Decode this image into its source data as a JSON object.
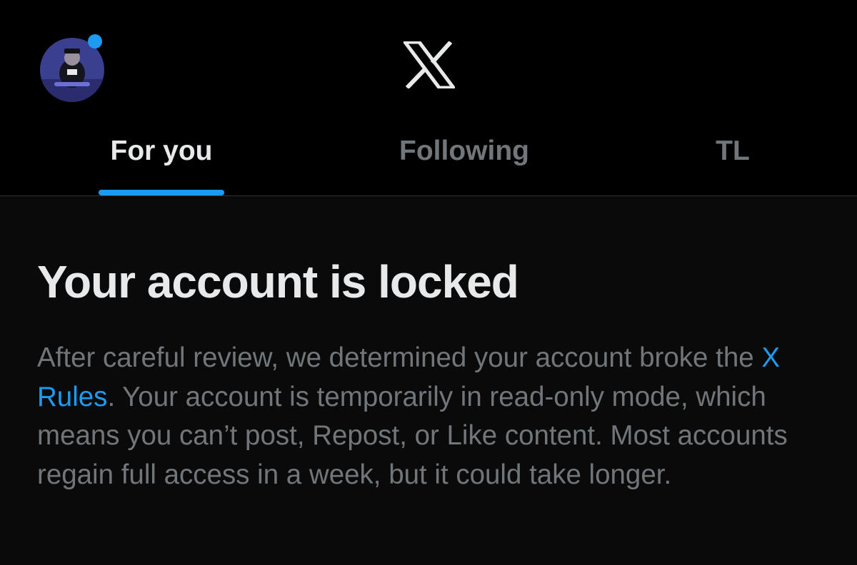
{
  "header": {
    "logo": "X",
    "avatar_icon": "profile-avatar",
    "notification_dot_color": "#1d9bf0"
  },
  "tabs": [
    {
      "label": "For you",
      "active": true
    },
    {
      "label": "Following",
      "active": false
    },
    {
      "label": "TL",
      "active": false
    }
  ],
  "colors": {
    "accent": "#1d9bf0",
    "tab_active": "#e7e9ea",
    "tab_inactive": "#71767b",
    "body_text": "#71767b",
    "title": "#e7e9ea"
  },
  "notice": {
    "title": "Your account is locked",
    "body_before_link": "After careful review, we determined your account broke the ",
    "link_text": "X Rules",
    "body_after_link": ". Your account is temporarily in read-only mode, which means you can’t post, Repost, or Like content. Most accounts regain full access in a week, but it could take longer."
  }
}
